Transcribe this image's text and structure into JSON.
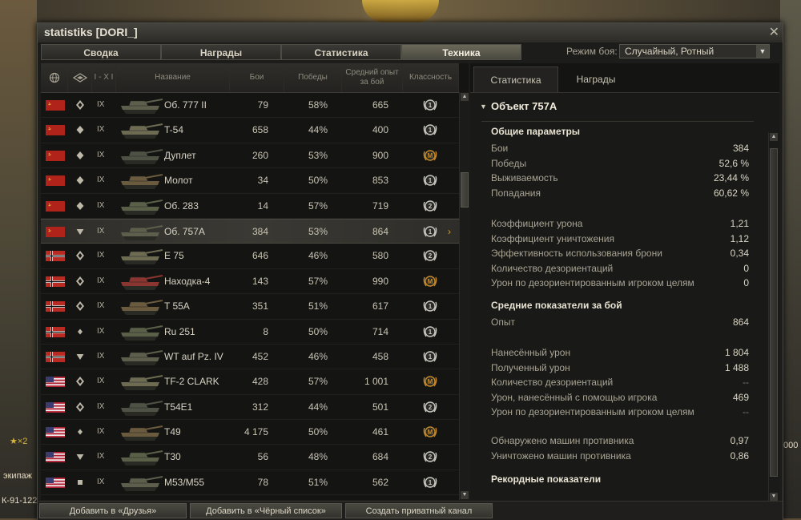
{
  "window": {
    "title": "statistiks [DORI_]",
    "close": "✕"
  },
  "tabs": [
    {
      "label": "Сводка"
    },
    {
      "label": "Награды"
    },
    {
      "label": "Статистика"
    },
    {
      "label": "Техника"
    }
  ],
  "battle_mode": {
    "label": "Режим боя:",
    "value": "Случайный, Ротный"
  },
  "table": {
    "headers": {
      "nation": "",
      "type": "",
      "level": "I - X I",
      "name": "Название",
      "battles": "Бои",
      "wins": "Победы",
      "avg_exp": "Средний опыт за бой",
      "mastery": "Классность"
    },
    "rows": [
      {
        "nation": "ussr",
        "type": "heavy",
        "level": "IX",
        "name": "Об. 777 II",
        "battles": "79",
        "wins": "58%",
        "exp": "665",
        "badge": "1"
      },
      {
        "nation": "ussr",
        "type": "medium",
        "level": "IX",
        "name": "T-54",
        "battles": "658",
        "wins": "44%",
        "exp": "400",
        "badge": "1"
      },
      {
        "nation": "ussr",
        "type": "medium",
        "level": "IX",
        "name": "Дуплет",
        "battles": "260",
        "wins": "53%",
        "exp": "900",
        "badge": "M"
      },
      {
        "nation": "ussr",
        "type": "medium",
        "level": "IX",
        "name": "Молот",
        "battles": "34",
        "wins": "50%",
        "exp": "853",
        "badge": "1"
      },
      {
        "nation": "ussr",
        "type": "medium",
        "level": "IX",
        "name": "Об. 283",
        "battles": "14",
        "wins": "57%",
        "exp": "719",
        "badge": "2"
      },
      {
        "nation": "ussr",
        "type": "td",
        "level": "IX",
        "name": "Об. 757А",
        "battles": "384",
        "wins": "53%",
        "exp": "864",
        "badge": "1",
        "selected": true
      },
      {
        "nation": "germany",
        "type": "heavy",
        "level": "IX",
        "name": "E 75",
        "battles": "646",
        "wins": "46%",
        "exp": "580",
        "badge": "2"
      },
      {
        "nation": "germany",
        "type": "heavy",
        "level": "IX",
        "name": "Находка-4",
        "battles": "143",
        "wins": "57%",
        "exp": "990",
        "badge": "M"
      },
      {
        "nation": "germany",
        "type": "heavy",
        "level": "IX",
        "name": "T 55A",
        "battles": "351",
        "wins": "51%",
        "exp": "617",
        "badge": "1"
      },
      {
        "nation": "germany",
        "type": "light",
        "level": "IX",
        "name": "Ru 251",
        "battles": "8",
        "wins": "50%",
        "exp": "714",
        "badge": "1"
      },
      {
        "nation": "germany",
        "type": "td",
        "level": "IX",
        "name": "WT auf Pz. IV",
        "battles": "452",
        "wins": "46%",
        "exp": "458",
        "badge": "1"
      },
      {
        "nation": "usa",
        "type": "heavy",
        "level": "IX",
        "name": "TF-2 CLARK",
        "battles": "428",
        "wins": "57%",
        "exp": "1 001",
        "badge": "M"
      },
      {
        "nation": "usa",
        "type": "heavy",
        "level": "IX",
        "name": "T54E1",
        "battles": "312",
        "wins": "44%",
        "exp": "501",
        "badge": "2"
      },
      {
        "nation": "usa",
        "type": "light",
        "level": "IX",
        "name": "T49",
        "battles": "4 175",
        "wins": "50%",
        "exp": "461",
        "badge": "M"
      },
      {
        "nation": "usa",
        "type": "td",
        "level": "IX",
        "name": "T30",
        "battles": "56",
        "wins": "48%",
        "exp": "684",
        "badge": "2"
      },
      {
        "nation": "usa",
        "type": "spg",
        "level": "IX",
        "name": "M53/M55",
        "battles": "78",
        "wins": "51%",
        "exp": "562",
        "badge": "1"
      }
    ]
  },
  "right": {
    "tabs": [
      {
        "label": "Статистика"
      },
      {
        "label": "Награды"
      }
    ],
    "vehicle": "Объект 757А",
    "general": {
      "title": "Общие параметры",
      "rows": [
        {
          "label": "Бои",
          "value": "384"
        },
        {
          "label": "Победы",
          "value": "52,6 %"
        },
        {
          "label": "Выживаемость",
          "value": "23,44 %"
        },
        {
          "label": "Попадания",
          "value": "60,62 %"
        }
      ],
      "rows2": [
        {
          "label": "Коэффициент урона",
          "value": "1,21"
        },
        {
          "label": "Коэффициент уничтожения",
          "value": "1,12"
        },
        {
          "label": "Эффективность использования брони",
          "value": "0,34"
        },
        {
          "label": "Количество дезориентаций",
          "value": "0"
        },
        {
          "label": "Урон по дезориентированным игроком целям",
          "value": "0"
        }
      ]
    },
    "avg": {
      "title": "Средние показатели за бой",
      "rows": [
        {
          "label": "Опыт",
          "value": "864"
        }
      ],
      "rows2": [
        {
          "label": "Нанесённый урон",
          "value": "1 804"
        },
        {
          "label": "Полученный урон",
          "value": "1 488"
        },
        {
          "label": "Количество дезориентаций",
          "value": "--"
        },
        {
          "label": "Урон, нанесённый с помощью игрока",
          "value": "469"
        },
        {
          "label": "Урон по дезориентированным игроком целям",
          "value": "--"
        }
      ],
      "rows3": [
        {
          "label": "Обнаружено машин противника",
          "value": "0,97"
        },
        {
          "label": "Уничтожено машин противника",
          "value": "0,86"
        }
      ]
    },
    "records": {
      "title": "Рекордные показатели"
    }
  },
  "footer": {
    "add_friend": "Добавить в «Друзья»",
    "add_blacklist": "Добавить в «Чёрный список»",
    "create_channel": "Создать приватный канал"
  },
  "background": {
    "left_badge": "★×2",
    "left_crew": "экипаж",
    "left_tank": "К-91-122",
    "right_num": "000"
  },
  "colors": {
    "accent": "#e39d1f",
    "ussr_flag": "#b0231b",
    "usa_flag": "#b22234"
  }
}
